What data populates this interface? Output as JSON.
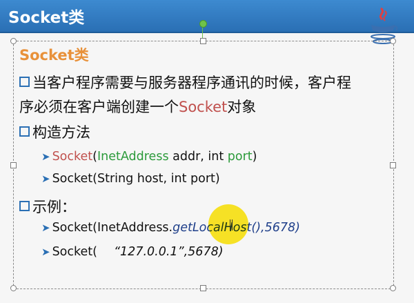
{
  "header": {
    "title": "Socket类"
  },
  "slide": {
    "subtitle": "Socket类",
    "bullet1": {
      "part1": "当客户程序需要与服务器程序通讯的时候，客户程",
      "part2_a": "序必须在客户端创建一个",
      "part2_socket": "Socket",
      "part2_b": "对象"
    },
    "bullet2": {
      "label": "构造方法",
      "item1": {
        "socket": "Socket",
        "paren_open": "(",
        "type": "InetAddress",
        "arg1": " addr, int ",
        "port": "port",
        "paren_close": ")"
      },
      "item2": "Socket(String host, int port)"
    },
    "bullet3": {
      "label": "示例：",
      "ex1_a": "Socket(InetAddress.",
      "ex1_b": "getLocalHost(),5678)",
      "ex2_a": "Socket(",
      "ex2_b": "“127.0.0.1”,5678)"
    }
  },
  "colors": {
    "title_bar": "#2a6fb4",
    "subtitle": "#e8913a",
    "socket_red": "#c0504d",
    "green": "#2b9a3a",
    "highlight": "#ffe600"
  },
  "icons": [
    "java-logo-icon",
    "checkbox-bullet-icon",
    "arrow-bullet-icon",
    "text-cursor-icon"
  ]
}
